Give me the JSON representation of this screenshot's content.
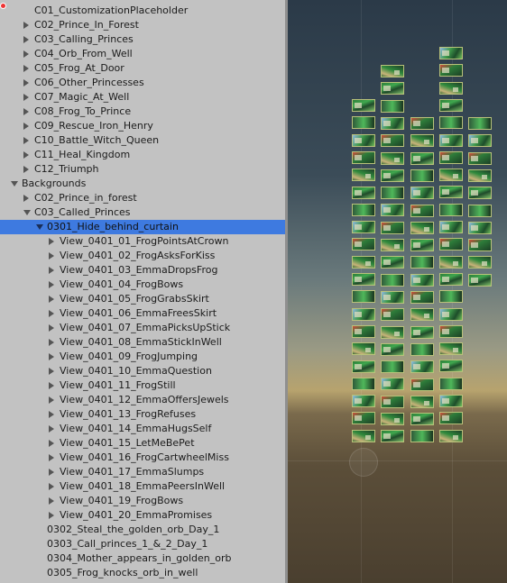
{
  "hierarchy": {
    "items": [
      {
        "label": "C01_CustomizationPlaceholder",
        "arrow": "none"
      },
      {
        "label": "C02_Prince_In_Forest",
        "arrow": "collapsed"
      },
      {
        "label": "C03_Calling_Princes",
        "arrow": "collapsed"
      },
      {
        "label": "C04_Orb_From_Well",
        "arrow": "collapsed"
      },
      {
        "label": "C05_Frog_At_Door",
        "arrow": "collapsed"
      },
      {
        "label": "C06_Other_Princesses",
        "arrow": "collapsed"
      },
      {
        "label": "C07_Magic_At_Well",
        "arrow": "collapsed"
      },
      {
        "label": "C08_Frog_To_Prince",
        "arrow": "collapsed"
      },
      {
        "label": "C09_Rescue_Iron_Henry",
        "arrow": "collapsed"
      },
      {
        "label": "C10_Battle_Witch_Queen",
        "arrow": "collapsed"
      },
      {
        "label": "C11_Heal_Kingdom",
        "arrow": "collapsed"
      },
      {
        "label": "C12_Triumph",
        "arrow": "collapsed"
      },
      {
        "label": "Backgrounds",
        "arrow": "expanded"
      },
      {
        "label": "C02_Prince_in_forest",
        "arrow": "collapsed"
      },
      {
        "label": "C03_Called_Princes",
        "arrow": "expanded"
      },
      {
        "label": "0301_Hide_behind_curtain",
        "arrow": "expanded",
        "selected": true
      },
      {
        "label": "View_0401_01_FrogPointsAtCrown",
        "arrow": "collapsed"
      },
      {
        "label": "View_0401_02_FrogAsksForKiss",
        "arrow": "collapsed"
      },
      {
        "label": "View_0401_03_EmmaDropsFrog",
        "arrow": "collapsed"
      },
      {
        "label": "View_0401_04_FrogBows",
        "arrow": "collapsed"
      },
      {
        "label": "View_0401_05_FrogGrabsSkirt",
        "arrow": "collapsed"
      },
      {
        "label": "View_0401_06_EmmaFreesSkirt",
        "arrow": "collapsed"
      },
      {
        "label": "View_0401_07_EmmaPicksUpStick",
        "arrow": "collapsed"
      },
      {
        "label": "View_0401_08_EmmaStickInWell",
        "arrow": "collapsed"
      },
      {
        "label": "View_0401_09_FrogJumping",
        "arrow": "collapsed"
      },
      {
        "label": "View_0401_10_EmmaQuestion",
        "arrow": "collapsed"
      },
      {
        "label": "View_0401_11_FrogStill",
        "arrow": "collapsed"
      },
      {
        "label": "View_0401_12_EmmaOffersJewels",
        "arrow": "collapsed"
      },
      {
        "label": "View_0401_13_FrogRefuses",
        "arrow": "collapsed"
      },
      {
        "label": "View_0401_14_EmmaHugsSelf",
        "arrow": "collapsed"
      },
      {
        "label": "View_0401_15_LetMeBePet",
        "arrow": "collapsed"
      },
      {
        "label": "View_0401_16_FrogCartwheelMiss",
        "arrow": "collapsed"
      },
      {
        "label": "View_0401_17_EmmaSlumps",
        "arrow": "collapsed"
      },
      {
        "label": "View_0401_18_EmmaPeersInWell",
        "arrow": "collapsed"
      },
      {
        "label": "View_0401_19_FrogBows",
        "arrow": "collapsed"
      },
      {
        "label": "View_0401_20_EmmaPromises",
        "arrow": "collapsed"
      },
      {
        "label": "0302_Steal_the_golden_orb_Day_1",
        "arrow": "none"
      },
      {
        "label": "0303_Call_princes_1_&_2_Day_1",
        "arrow": "none"
      },
      {
        "label": "0304_Mother_appears_in_golden_orb",
        "arrow": "none"
      },
      {
        "label": "0305_Frog_knocks_orb_in_well",
        "arrow": "none"
      }
    ]
  },
  "scene_view": {
    "thumbnail_columns": [
      {
        "count": 20
      },
      {
        "count": 22
      },
      {
        "count": 19
      },
      {
        "count": 23
      },
      {
        "count": 10
      }
    ]
  }
}
